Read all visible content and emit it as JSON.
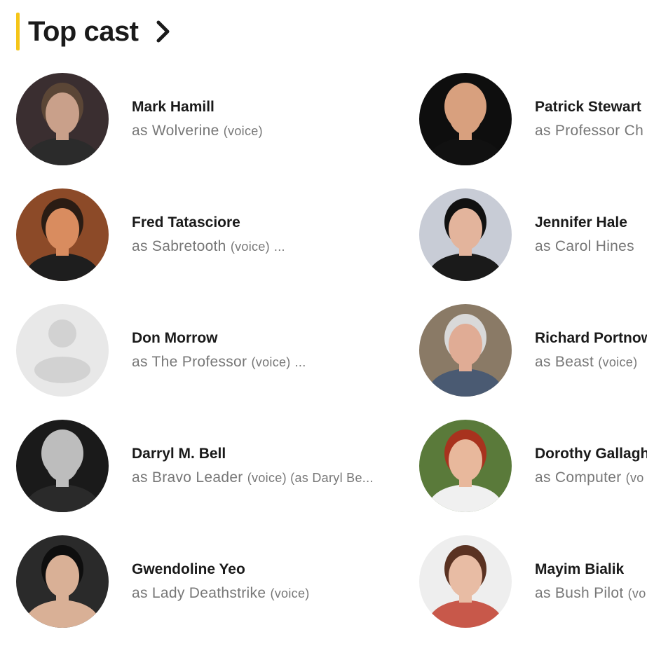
{
  "section": {
    "title": "Top cast",
    "accent_color": "#f5c518"
  },
  "cast": [
    {
      "name": "Mark Hamill",
      "as": "as",
      "character": "Wolverine",
      "note": "(voice)",
      "more": "",
      "avatar": "photo",
      "colors": {
        "bg": "#3a2e30",
        "skin": "#c9a08a",
        "hair": "#5b4636",
        "shirt": "#2b2b2b"
      }
    },
    {
      "name": "Patrick Stewart",
      "as": "as",
      "character": "Professor Ch",
      "note": "",
      "more": "",
      "avatar": "photo",
      "colors": {
        "bg": "#0e0e0e",
        "skin": "#d8a07e",
        "hair": "#d8a07e",
        "shirt": "#111111"
      }
    },
    {
      "name": "Fred Tatasciore",
      "as": "as",
      "character": "Sabretooth",
      "note": "(voice)",
      "more": "...",
      "avatar": "photo",
      "colors": {
        "bg": "#8c4a28",
        "skin": "#d98c5f",
        "hair": "#2a1c14",
        "shirt": "#1e1e1e"
      }
    },
    {
      "name": "Jennifer Hale",
      "as": "as",
      "character": "Carol Hines",
      "note": "",
      "more": "",
      "avatar": "photo",
      "colors": {
        "bg": "#c8ccd6",
        "skin": "#e3b49c",
        "hair": "#111111",
        "shirt": "#1a1a1a"
      }
    },
    {
      "name": "Don Morrow",
      "as": "as",
      "character": "The Professor",
      "note": "(voice)",
      "more": "...",
      "avatar": "placeholder",
      "colors": {
        "bg": "#e8e8e8",
        "skin": "#d2d2d2",
        "hair": "#d2d2d2",
        "shirt": "#d2d2d2"
      }
    },
    {
      "name": "Richard Portnow",
      "as": "as",
      "character": "Beast",
      "note": "(voice)",
      "more": "",
      "avatar": "photo",
      "colors": {
        "bg": "#8a7a66",
        "skin": "#e0ac95",
        "hair": "#d9d9d9",
        "shirt": "#4a5a72"
      }
    },
    {
      "name": "Darryl M. Bell",
      "as": "as",
      "character": "Bravo Leader",
      "note": "(voice) (as Daryl Be...",
      "more": "",
      "avatar": "photo",
      "colors": {
        "bg": "#1a1a1a",
        "skin": "#bdbdbd",
        "hair": "#bdbdbd",
        "shirt": "#2a2a2a"
      }
    },
    {
      "name": "Dorothy Gallagh",
      "as": "as",
      "character": "Computer",
      "note": "(vo",
      "more": "",
      "avatar": "photo",
      "colors": {
        "bg": "#5a7a3a",
        "skin": "#e8b89c",
        "hair": "#a8321e",
        "shirt": "#f0f0f0"
      }
    },
    {
      "name": "Gwendoline Yeo",
      "as": "as",
      "character": "Lady Deathstrike",
      "note": "(voice)",
      "more": "",
      "avatar": "photo",
      "colors": {
        "bg": "#2a2a2a",
        "skin": "#d9b096",
        "hair": "#0e0e0e",
        "shirt": "#d9b096"
      }
    },
    {
      "name": "Mayim Bialik",
      "as": "as",
      "character": "Bush Pilot",
      "note": "(vo",
      "more": "",
      "avatar": "photo",
      "colors": {
        "bg": "#eeeeee",
        "skin": "#e8bca4",
        "hair": "#5a3222",
        "shirt": "#c8584a"
      }
    }
  ]
}
